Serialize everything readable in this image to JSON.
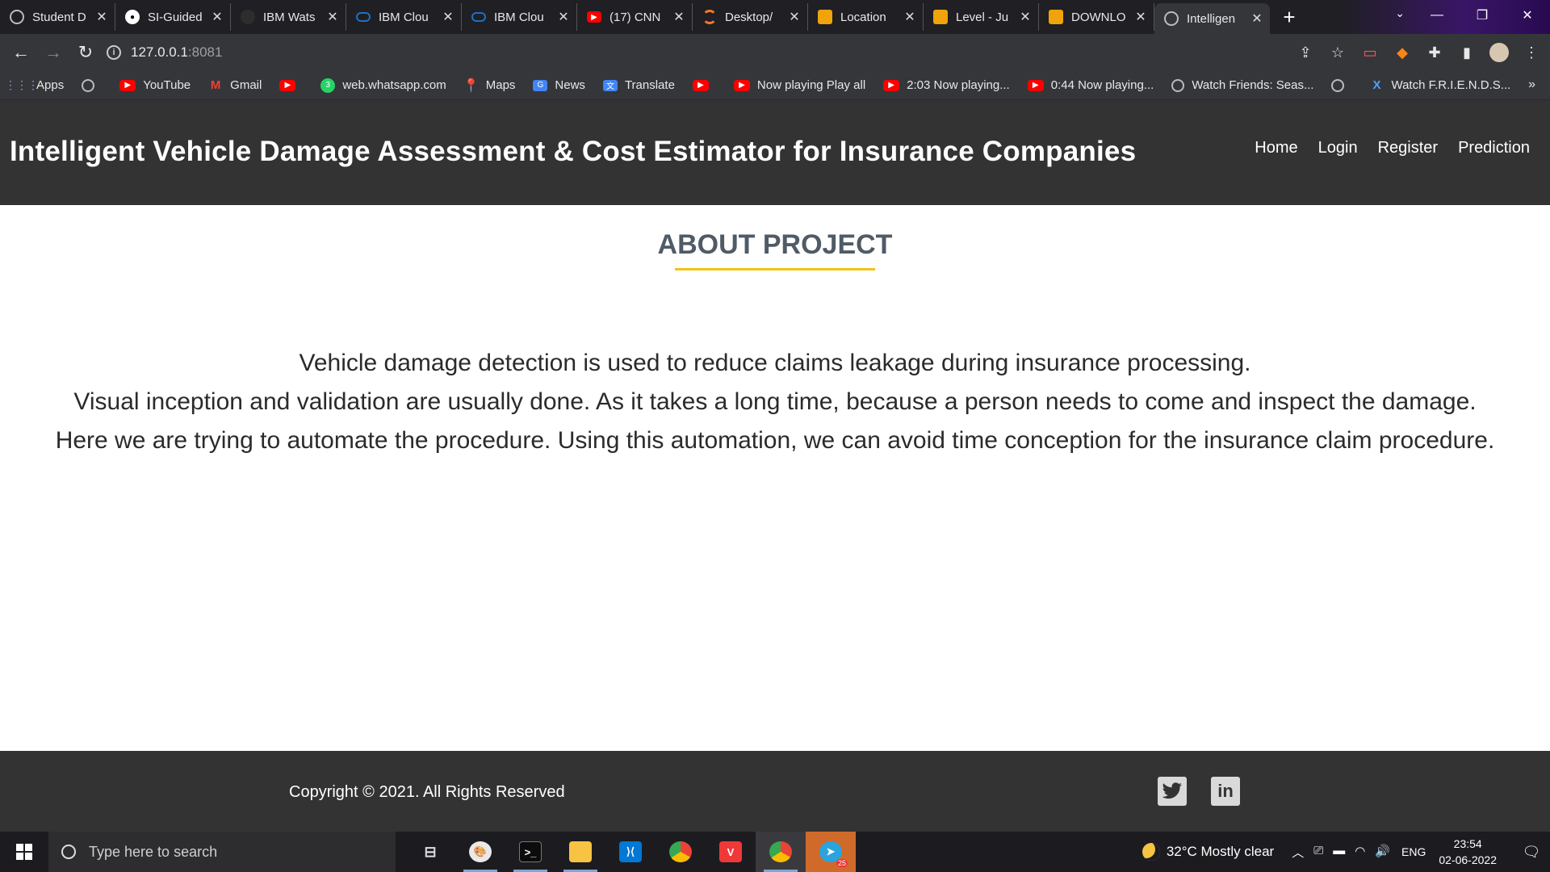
{
  "browser": {
    "tabs": [
      {
        "label": "Student D",
        "icon": "globe-icon",
        "color": "#8a8a8a"
      },
      {
        "label": "SI-Guided",
        "icon": "github-icon",
        "color": "#ffffff"
      },
      {
        "label": "IBM Wats",
        "icon": "ibm-watson-icon",
        "color": "#2d2d2d"
      },
      {
        "label": "IBM Clou",
        "icon": "ibm-cloud-icon",
        "color": "#1f70c1"
      },
      {
        "label": "IBM Clou",
        "icon": "ibm-cloud-icon",
        "color": "#1f70c1"
      },
      {
        "label": "(17) CNN",
        "icon": "youtube-icon",
        "color": "#ff0000"
      },
      {
        "label": "Desktop/",
        "icon": "jupyter-icon",
        "color": "#f37726"
      },
      {
        "label": "Location",
        "icon": "notebook-icon",
        "color": "#f0a30a"
      },
      {
        "label": "Level - Ju",
        "icon": "notebook-icon",
        "color": "#f0a30a"
      },
      {
        "label": "DOWNLO",
        "icon": "notebook-icon",
        "color": "#f0a30a"
      },
      {
        "label": "Intelligen",
        "icon": "globe-icon",
        "color": "#8a8a8a"
      }
    ],
    "url": {
      "host": "127.0.0.1",
      "port": ":8081"
    },
    "bookmarks": [
      {
        "label": "Apps",
        "icon": "apps-grid-icon"
      },
      {
        "label": "",
        "icon": "globe-icon"
      },
      {
        "label": "YouTube",
        "icon": "youtube-icon"
      },
      {
        "label": "Gmail",
        "icon": "gmail-icon"
      },
      {
        "label": "",
        "icon": "youtube-icon"
      },
      {
        "label": "web.whatsapp.com",
        "icon": "whatsapp-icon"
      },
      {
        "label": "Maps",
        "icon": "maps-icon"
      },
      {
        "label": "News",
        "icon": "news-icon"
      },
      {
        "label": "Translate",
        "icon": "translate-icon"
      },
      {
        "label": "",
        "icon": "youtube-icon"
      },
      {
        "label": "Now playing Play all",
        "icon": "youtube-icon"
      },
      {
        "label": "2:03 Now playing...",
        "icon": "youtube-icon"
      },
      {
        "label": "0:44 Now playing...",
        "icon": "youtube-icon"
      },
      {
        "label": "Watch Friends: Seas...",
        "icon": "globe-icon"
      },
      {
        "label": "",
        "icon": "globe-icon"
      },
      {
        "label": "Watch F.R.I.E.N.D.S...",
        "icon": "x-logo-icon"
      }
    ]
  },
  "header": {
    "title": "Intelligent Vehicle Damage Assessment & Cost Estimator for Insurance Companies",
    "nav": [
      "Home",
      "Login",
      "Register",
      "Prediction"
    ]
  },
  "main": {
    "section_title": "ABOUT PROJECT",
    "paragraphs": [
      "Vehicle damage detection is used to reduce claims leakage during insurance processing.",
      "Visual inception and validation are usually done. As it takes a long time, because a person needs to come and inspect the damage.",
      "Here we are trying to automate the procedure. Using this automation, we can avoid time conception for the insurance claim procedure."
    ],
    "accent_color": "#f0c419"
  },
  "footer": {
    "copyright": "Copyright © 2021. All Rights Reserved",
    "social": [
      {
        "name": "twitter-icon",
        "glyph": "🐦"
      },
      {
        "name": "linkedin-icon",
        "glyph": "in"
      }
    ]
  },
  "taskbar": {
    "search_placeholder": "Type here to search",
    "weather": "32°C  Mostly clear",
    "language": "ENG",
    "time": "23:54",
    "date": "02-06-2022",
    "telegram_badge": "25"
  }
}
